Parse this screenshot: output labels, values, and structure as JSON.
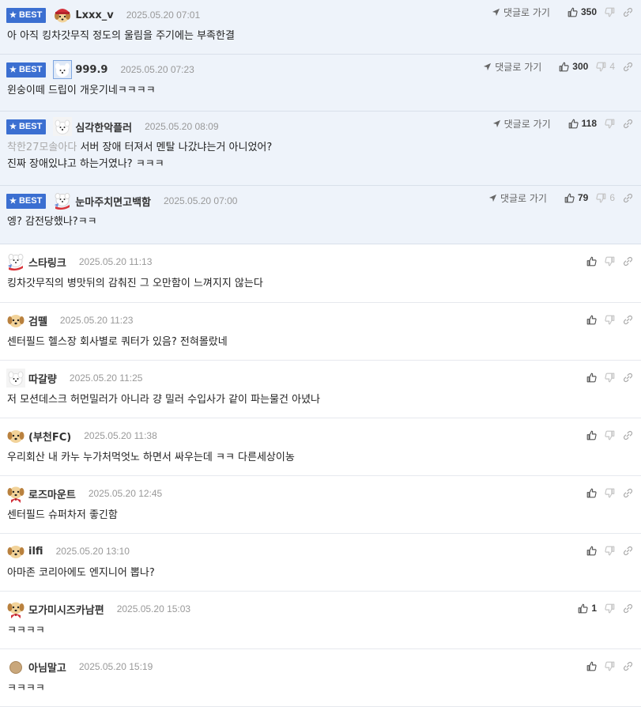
{
  "best_badge_label": "BEST",
  "reply_link_label": "댓글로 가기",
  "colors": {
    "best_bg": "#eef3fa",
    "badge": "#3b6fd1",
    "date": "#999999",
    "mention": "#aaaaaa"
  },
  "comments": [
    {
      "nick": "Lxxx_v",
      "date": "2025.05.20 07:01",
      "line1": "아 아직 킹차갓무직 정도의 울림을 주기에는 부족한결",
      "likes": "350",
      "dislikes": "",
      "avatar": "dog-red-hat-icon"
    },
    {
      "nick": "999.9",
      "date": "2025.05.20 07:23",
      "line1": "윈숭이떼 드립이 개웃기네ㅋㅋㅋㅋ",
      "likes": "300",
      "dislikes": "4",
      "avatar": "white-dog-blue-bg-icon"
    },
    {
      "nick": "심각한악플러",
      "date": "2025.05.20 08:09",
      "mention": "착한27모솔아다",
      "line1": " 서버 장애 터져서 멘탈 나갔냐는거 아니었어?",
      "line2": "진짜 장애있냐고 하는거였나? ㅋㅋㅋ",
      "likes": "118",
      "dislikes": "",
      "avatar": "white-dog-icon"
    },
    {
      "nick": "눈마주치면고백함",
      "date": "2025.05.20 07:00",
      "line1": "엥? 감전당했나?ㅋㅋ",
      "likes": "79",
      "dislikes": "6",
      "avatar": "white-dog-scarf-icon"
    },
    {
      "nick": "스타링크",
      "date": "2025.05.20 11:13",
      "line1": "킹차갓무직의 병맛뒤의 감춰진 그 오만함이 느껴지지 않는다",
      "likes": "",
      "dislikes": "",
      "avatar": "white-dog-scarf-icon"
    },
    {
      "nick": "검뗄",
      "date": "2025.05.20 11:23",
      "line1": "센터필드 헬스장 회사별로 쿼터가 있음? 전혀몰랐네",
      "likes": "",
      "dislikes": "",
      "avatar": "puppy-icon"
    },
    {
      "nick": "따갈량",
      "date": "2025.05.20 11:25",
      "line1": "저 모션데스크 허먼밀러가 아니라 걍 밀러 수입사가 같이 파는물건 아녔나",
      "likes": "",
      "dislikes": "",
      "avatar": "white-dog-icon"
    },
    {
      "nick": "(부천FC)",
      "date": "2025.05.20 11:38",
      "line1": "우리회산 내 카누 누가처먹엇노 하면서 싸우는데 ㅋㅋ 다른세상이농",
      "likes": "",
      "dislikes": "",
      "avatar": "puppy-icon"
    },
    {
      "nick": "로즈마운트",
      "date": "2025.05.20 12:45",
      "line1": "센터필드 슈퍼차저 좋긴함",
      "likes": "",
      "dislikes": "",
      "avatar": "puppy-bow-icon"
    },
    {
      "nick": "ilfi",
      "date": "2025.05.20 13:10",
      "line1": "아마존 코리아에도 엔지니어 뽑나?",
      "likes": "",
      "dislikes": "",
      "avatar": "puppy-icon"
    },
    {
      "nick": "모가미시즈카남편",
      "date": "2025.05.20 15:03",
      "line1": "ㅋㅋㅋㅋ",
      "likes": "1",
      "dislikes": "",
      "avatar": "puppy-bow-icon"
    },
    {
      "nick": "아님말고",
      "date": "2025.05.20 15:19",
      "line1": "ㅋㅋㅋㅋ",
      "likes": "",
      "dislikes": "",
      "avatar": "brown-circle-icon"
    }
  ]
}
